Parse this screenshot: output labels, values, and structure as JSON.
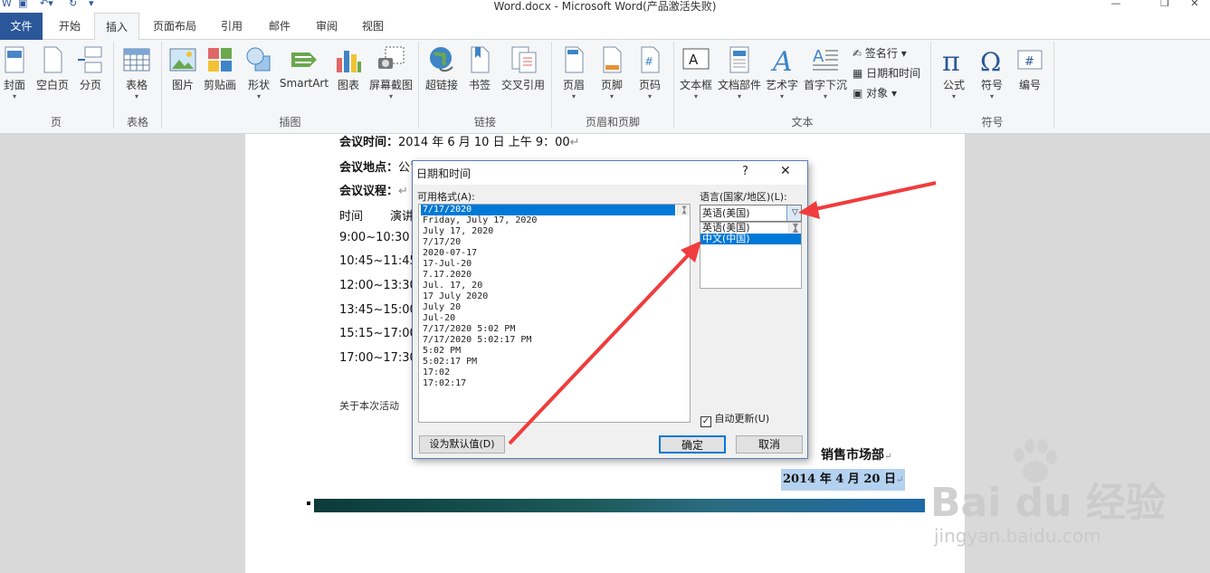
{
  "window": {
    "title": "Word.docx  -  Microsoft Word(产品激活失败)",
    "minimize": "—",
    "restore": "❐",
    "close": "✕"
  },
  "tabs": [
    "文件",
    "开始",
    "插入",
    "页面布局",
    "引用",
    "邮件",
    "审阅",
    "视图"
  ],
  "ribbon": {
    "page_group": {
      "label": "页",
      "buttons": [
        "封面",
        "空白页",
        "分页"
      ]
    },
    "table_group": {
      "label": "表格",
      "buttons": [
        "表格"
      ]
    },
    "illustrations_group": {
      "label": "插图",
      "buttons": [
        "图片",
        "剪贴画",
        "形状",
        "SmartArt",
        "图表",
        "屏幕截图"
      ]
    },
    "links_group": {
      "label": "链接",
      "buttons": [
        "超链接",
        "书签",
        "交叉引用"
      ]
    },
    "header_footer_group": {
      "label": "页眉和页脚",
      "buttons": [
        "页眉",
        "页脚",
        "页码"
      ]
    },
    "text_group": {
      "label": "文本",
      "buttons": [
        "文本框",
        "文档部件",
        "艺术字",
        "首字下沉"
      ],
      "small": [
        "签名行",
        "日期和时间",
        "对象"
      ]
    },
    "symbols_group": {
      "label": "符号",
      "buttons": [
        "公式",
        "符号",
        "编号"
      ]
    }
  },
  "document": {
    "meeting_time_label": "会议时间：",
    "meeting_time_value": "2014 年 6 月 10 日 上午 9：00",
    "meeting_place_label": "会议地点：",
    "meeting_place_value": "公司会议室",
    "agenda_label": "会议议程：",
    "col_time": "时间",
    "col_speaker": "演讲",
    "times": [
      "9:00~10:30",
      "10:45~11:45",
      "12:00~13:30",
      "13:45~15:00",
      "15:15~17:00",
      "17:00~17:30"
    ],
    "note": "关于本次活动",
    "department": "销售市场部",
    "date": "2014 年 4 月 20 日"
  },
  "dialog": {
    "title": "日期和时间",
    "help": "?",
    "close": "✕",
    "formats_label": "可用格式(A):",
    "formats": [
      "7/17/2020",
      "Friday, July 17, 2020",
      "July 17, 2020",
      "7/17/20",
      "2020-07-17",
      "17-Jul-20",
      "7.17.2020",
      "Jul. 17, 20",
      "17 July 2020",
      "July 20",
      "Jul-20",
      "7/17/2020 5:02 PM",
      "7/17/2020 5:02:17 PM",
      "5:02 PM",
      "5:02:17 PM",
      "17:02",
      "17:02:17"
    ],
    "language_label": "语言(国家/地区)(L):",
    "language_value": "英语(美国)",
    "language_options": [
      "英语(美国)",
      "中文(中国)"
    ],
    "auto_update": "自动更新(U)",
    "auto_update_checked": true,
    "set_default": "设为默认值(D)",
    "ok": "确定",
    "cancel": "取消"
  },
  "watermark": {
    "brand": "Bai du 经验",
    "url": "jingyan.baidu.com"
  },
  "colors": {
    "accent": "#2b579a",
    "selection": "#0078d7",
    "arrow": "#f03c3c"
  }
}
